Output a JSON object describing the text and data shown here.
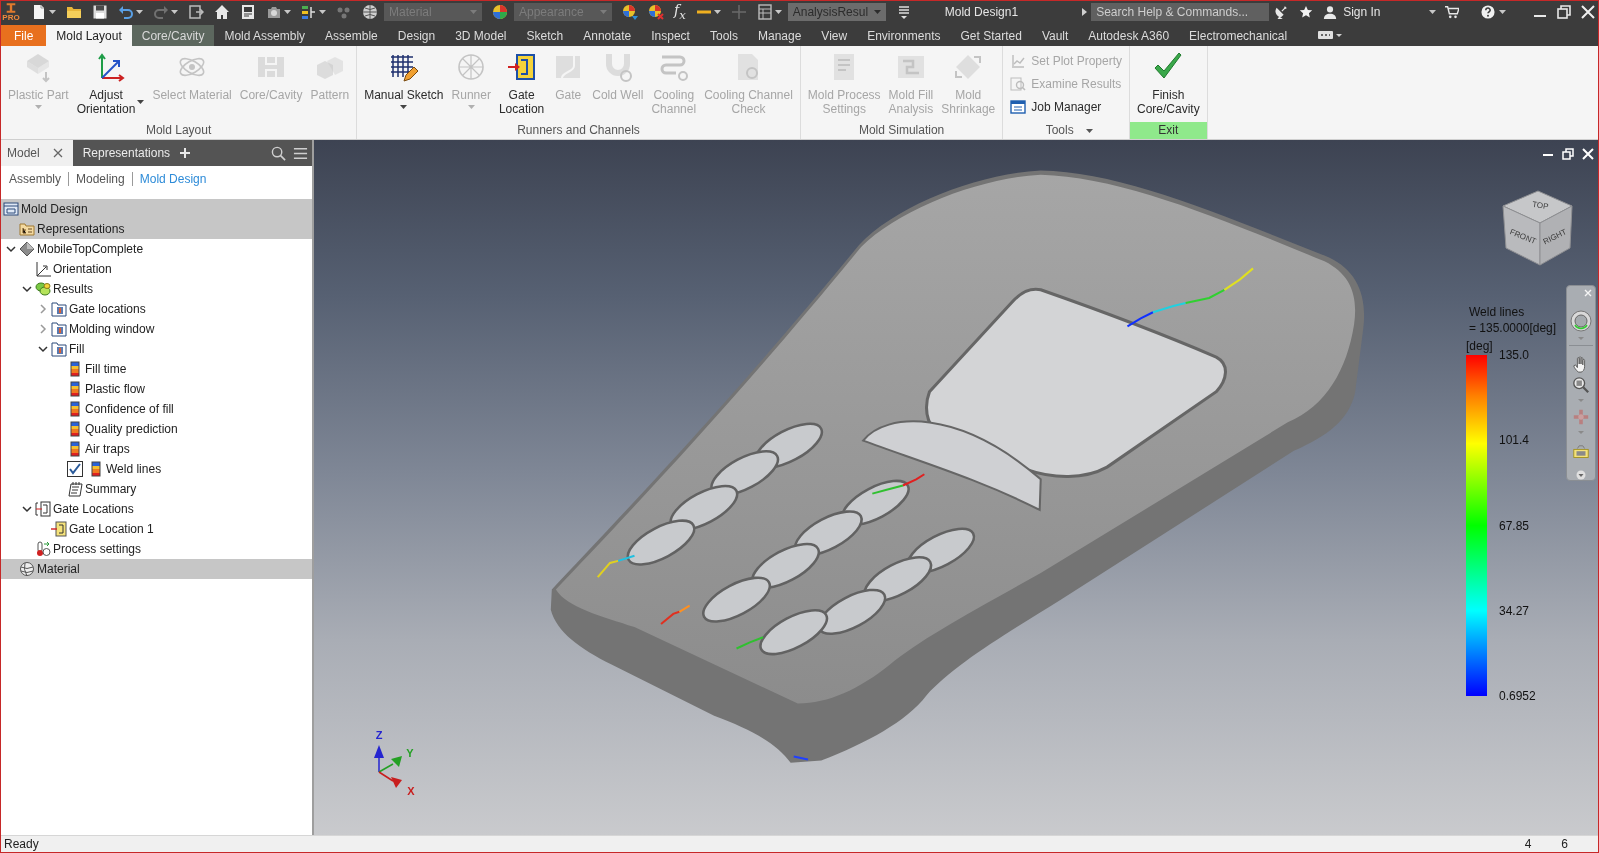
{
  "title_bar": {
    "badge": "PRO",
    "dropdowns": [
      {
        "value": "Material",
        "disabled": true
      },
      {
        "value": "Appearance",
        "disabled": true
      },
      {
        "value": "AnalysisResul",
        "disabled": false
      }
    ],
    "formula": "f$_{x}$",
    "title": "Mold Design1",
    "search": {
      "placeholder": "Search Help & Commands..."
    },
    "sign_in": "Sign In"
  },
  "tabs": [
    {
      "label": "File",
      "kind": "file",
      "selected": false
    },
    {
      "label": "Mold Layout",
      "kind": "plain",
      "selected": true
    },
    {
      "label": "Core/Cavity",
      "kind": "context",
      "selected": false
    },
    {
      "label": "Mold Assembly",
      "kind": "plain",
      "selected": false
    },
    {
      "label": "Assemble",
      "kind": "plain",
      "selected": false
    },
    {
      "label": "Design",
      "kind": "plain",
      "selected": false
    },
    {
      "label": "3D Model",
      "kind": "plain",
      "selected": false
    },
    {
      "label": "Sketch",
      "kind": "plain",
      "selected": false
    },
    {
      "label": "Annotate",
      "kind": "plain",
      "selected": false
    },
    {
      "label": "Inspect",
      "kind": "plain",
      "selected": false
    },
    {
      "label": "Tools",
      "kind": "plain",
      "selected": false
    },
    {
      "label": "Manage",
      "kind": "plain",
      "selected": false
    },
    {
      "label": "View",
      "kind": "plain",
      "selected": false
    },
    {
      "label": "Environments",
      "kind": "plain",
      "selected": false
    },
    {
      "label": "Get Started",
      "kind": "plain",
      "selected": false
    },
    {
      "label": "Vault",
      "kind": "plain",
      "selected": false
    },
    {
      "label": "Autodesk A360",
      "kind": "plain",
      "selected": false
    },
    {
      "label": "Electromechanical",
      "kind": "plain",
      "selected": false
    }
  ],
  "ribbon": {
    "groups": [
      {
        "label": "Mold Layout",
        "caret": false,
        "highlighted": false,
        "buttons": [
          {
            "kind": "large",
            "label": "Plastic Part",
            "disabled": true,
            "caret": true
          },
          {
            "kind": "large",
            "label": "Adjust\nOrientation",
            "disabled": false,
            "caret": true
          },
          {
            "kind": "large",
            "label": "Select Material",
            "disabled": true,
            "caret": false
          },
          {
            "kind": "large",
            "label": "Core/Cavity",
            "disabled": true,
            "caret": false
          },
          {
            "kind": "large",
            "label": "Pattern",
            "disabled": true,
            "caret": false
          }
        ]
      },
      {
        "label": "Runners and Channels",
        "caret": false,
        "highlighted": false,
        "buttons": [
          {
            "kind": "large",
            "label": "Manual Sketch",
            "disabled": false,
            "caret": true
          },
          {
            "kind": "large",
            "label": "Runner",
            "disabled": true,
            "caret": true
          },
          {
            "kind": "large",
            "label": "Gate\nLocation",
            "disabled": false,
            "caret": false
          },
          {
            "kind": "large",
            "label": "Gate",
            "disabled": true,
            "caret": false
          },
          {
            "kind": "large",
            "label": "Cold Well",
            "disabled": true,
            "caret": false
          },
          {
            "kind": "large",
            "label": "Cooling\nChannel",
            "disabled": true,
            "caret": false
          },
          {
            "kind": "large",
            "label": "Cooling Channel\nCheck",
            "disabled": true,
            "caret": false
          }
        ]
      },
      {
        "label": "Mold Simulation",
        "caret": false,
        "highlighted": false,
        "buttons": [
          {
            "kind": "large",
            "label": "Mold Process\nSettings",
            "disabled": true,
            "caret": false
          },
          {
            "kind": "large",
            "label": "Mold Fill\nAnalysis",
            "disabled": true,
            "caret": false
          },
          {
            "kind": "large",
            "label": "Mold\nShrinkage",
            "disabled": true,
            "caret": false
          }
        ]
      },
      {
        "label": "Tools",
        "caret": true,
        "highlighted": false,
        "buttons": [
          {
            "kind": "small",
            "label": "Set Plot Property",
            "disabled": true,
            "caret": false
          },
          {
            "kind": "small",
            "label": "Examine Results",
            "disabled": true,
            "caret": false
          },
          {
            "kind": "small",
            "label": "Job Manager",
            "disabled": false,
            "caret": false
          }
        ]
      },
      {
        "label": "Exit",
        "caret": false,
        "highlighted": true,
        "buttons": [
          {
            "kind": "large",
            "label": "Finish\nCore/Cavity",
            "disabled": false,
            "caret": false
          }
        ]
      }
    ]
  },
  "browser": {
    "tabs": [
      {
        "label": "Model",
        "selected": true,
        "closable": true
      },
      {
        "label": "Representations",
        "selected": false,
        "closable": false
      }
    ],
    "filters": [
      {
        "label": "Assembly",
        "selected": false
      },
      {
        "label": "Modeling",
        "selected": false
      },
      {
        "label": "Mold Design",
        "selected": true
      }
    ],
    "tree": [
      {
        "label": "Mold Design",
        "kind": "assembly",
        "shaded": true,
        "children": [
          {
            "label": "Representations",
            "kind": "representations",
            "shaded": true
          },
          {
            "label": "MobileTopComplete",
            "kind": "part",
            "shaded": false,
            "expanded": true,
            "children": [
              {
                "label": "Orientation",
                "kind": "orientation",
                "shaded": false
              },
              {
                "label": "Results",
                "kind": "results",
                "shaded": false,
                "expanded": true,
                "children": [
                  {
                    "label": "Gate locations",
                    "kind": "result-folder",
                    "shaded": false,
                    "expanded": false
                  },
                  {
                    "label": "Molding window",
                    "kind": "result-folder",
                    "shaded": false,
                    "expanded": false
                  },
                  {
                    "label": "Fill",
                    "kind": "result-folder",
                    "shaded": false,
                    "expanded": true,
                    "children": [
                      {
                        "label": "Fill time",
                        "kind": "result",
                        "shaded": false,
                        "checked": false
                      },
                      {
                        "label": "Plastic flow",
                        "kind": "result",
                        "shaded": false,
                        "checked": false
                      },
                      {
                        "label": "Confidence of fill",
                        "kind": "result",
                        "shaded": false,
                        "checked": false
                      },
                      {
                        "label": "Quality prediction",
                        "kind": "result",
                        "shaded": false,
                        "checked": false
                      },
                      {
                        "label": "Air traps",
                        "kind": "result",
                        "shaded": false,
                        "checked": false
                      },
                      {
                        "label": "Weld lines",
                        "kind": "result",
                        "shaded": false,
                        "checked": true
                      },
                      {
                        "label": "Summary",
                        "kind": "summary",
                        "shaded": false
                      }
                    ]
                  }
                ]
              },
              {
                "label": "Gate Locations",
                "kind": "gates",
                "shaded": false,
                "expanded": true,
                "children": [
                  {
                    "label": "Gate Location 1",
                    "kind": "gate",
                    "shaded": false
                  }
                ]
              },
              {
                "label": "Process settings",
                "kind": "settings",
                "shaded": false
              }
            ]
          },
          {
            "label": "Material",
            "kind": "material",
            "shaded": true
          }
        ]
      }
    ]
  },
  "viewport": {
    "view_cube": [
      "TOP",
      "FRONT",
      "RIGHT"
    ],
    "legend": {
      "title": "Weld lines",
      "value": "= 135.0000[deg]",
      "unit": "[deg]",
      "ticks": [
        "135.0",
        "101.4",
        "67.85",
        "34.27",
        "0.6952"
      ]
    },
    "triad": [
      {
        "label": "Z",
        "color": "#2424d0"
      },
      {
        "label": "Y",
        "color": "#24a024"
      },
      {
        "label": "X",
        "color": "#c81e1e"
      }
    ]
  },
  "status_bar": {
    "message": "Ready",
    "counts": [
      "4",
      "6"
    ]
  }
}
